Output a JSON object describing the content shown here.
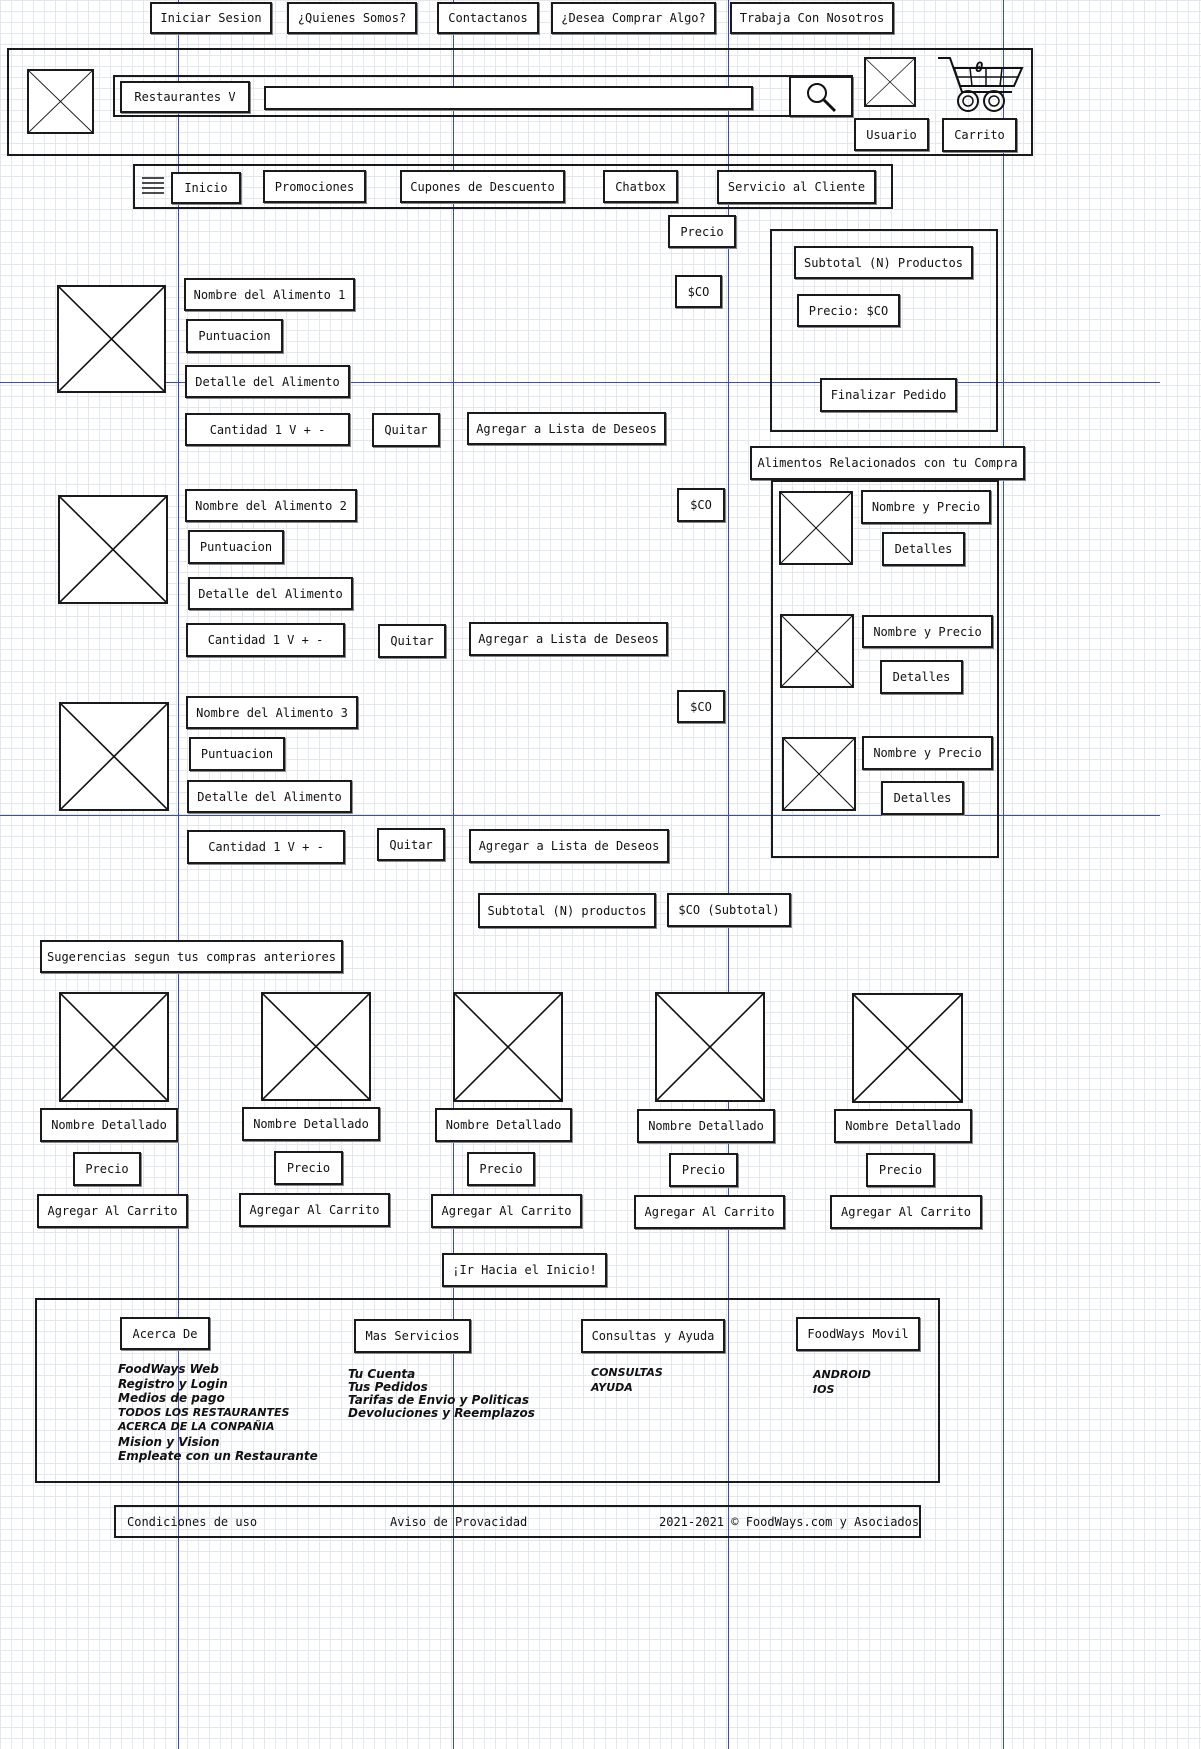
{
  "top_nav": [
    "Iniciar Sesion",
    "¿Quienes Somos?",
    "Contactanos",
    "¿Desea Comprar Algo?",
    "Trabaja Con Nosotros"
  ],
  "header": {
    "category_select": "Restaurantes  V",
    "search_value": "",
    "user_label": "Usuario",
    "cart_label": "Carrito",
    "cart_count": "0"
  },
  "menu_bar": [
    "Inicio",
    "Promociones",
    "Cupones de Descuento",
    "Chatbox",
    "Servicio al Cliente"
  ],
  "cart": {
    "price_header": "Precio",
    "items": [
      {
        "name": "Nombre del Alimento 1",
        "rating": "Puntuacion",
        "detail": "Detalle del Alimento",
        "qty": "Cantidad    1 V +  -",
        "remove": "Quitar",
        "wishlist": "Agregar a Lista de Deseos",
        "price": "$CO"
      },
      {
        "name": "Nombre del Alimento 2",
        "rating": "Puntuacion",
        "detail": "Detalle del Alimento",
        "qty": "Cantidad    1 V + -",
        "remove": "Quitar",
        "wishlist": "Agregar a Lista de Deseos",
        "price": "$CO"
      },
      {
        "name": "Nombre del Alimento 3",
        "rating": "Puntuacion",
        "detail": "Detalle del Alimento",
        "qty": "Cantidad    1 V + -",
        "remove": "Quitar",
        "wishlist": "Agregar a Lista de Deseos",
        "price": "$CO"
      }
    ],
    "subtotal_label": "Subtotal (N) productos",
    "subtotal_value": "$CO (Subtotal)"
  },
  "summary": {
    "subtotal": "Subtotal (N) Productos",
    "price": "Precio: $CO",
    "checkout": "Finalizar Pedido"
  },
  "related": {
    "title": "Alimentos Relacionados con tu Compra",
    "items": [
      {
        "name": "Nombre y Precio",
        "details": "Detalles"
      },
      {
        "name": "Nombre y Precio",
        "details": "Detalles"
      },
      {
        "name": "Nombre y Precio",
        "details": "Detalles"
      }
    ]
  },
  "suggestions": {
    "title": "Sugerencias segun tus compras anteriores",
    "items": [
      {
        "name": "Nombre Detallado",
        "price": "Precio",
        "add": "Agregar Al Carrito"
      },
      {
        "name": "Nombre Detallado",
        "price": "Precio",
        "add": "Agregar Al Carrito"
      },
      {
        "name": "Nombre Detallado",
        "price": "Precio",
        "add": "Agregar Al Carrito"
      },
      {
        "name": "Nombre Detallado",
        "price": "Precio",
        "add": "Agregar Al Carrito"
      },
      {
        "name": "Nombre Detallado",
        "price": "Precio",
        "add": "Agregar Al Carrito"
      }
    ]
  },
  "back_to_top": "¡Ir Hacia el Inicio!",
  "footer": {
    "columns": [
      {
        "title": "Acerca De",
        "links": [
          "FoodWays Web",
          "Registro y Login",
          "Medios de pago",
          "Todos los restaurantes",
          "acerca de la conpañia",
          "Mision y Vision",
          "Empleate con un Restaurante"
        ]
      },
      {
        "title": "Mas Servicios",
        "links": [
          "Tu Cuenta",
          "Tus Pedidos",
          "Tarifas de Envio y Politicas",
          "Devoluciones y Reemplazos"
        ]
      },
      {
        "title": "Consultas y Ayuda",
        "links": [
          "consultas",
          "ayuda"
        ]
      },
      {
        "title": "FoodWays Movil",
        "links": [
          "android",
          "iOS"
        ]
      }
    ]
  },
  "bottom_bar": {
    "terms": "Condiciones de uso",
    "privacy": "Aviso de Provacidad",
    "copyright": "2021-2021 © FoodWays.com y Asociados"
  }
}
